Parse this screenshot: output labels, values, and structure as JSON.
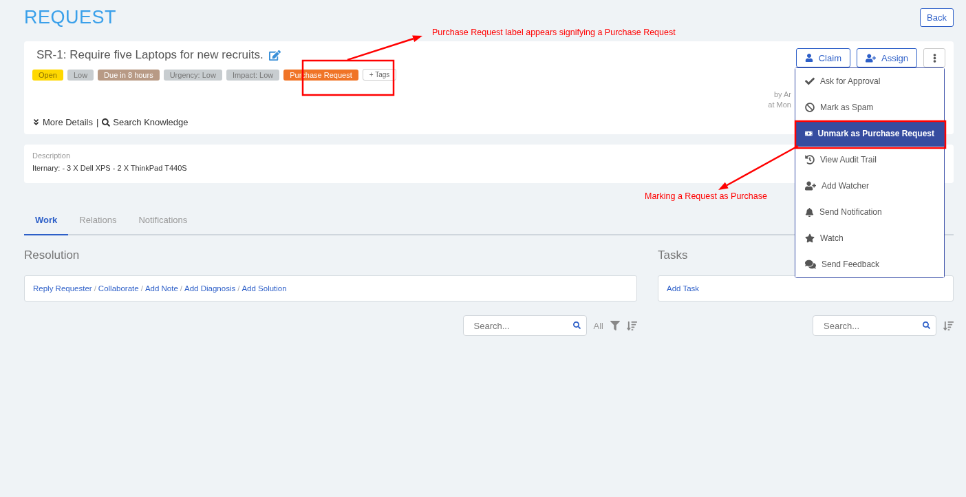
{
  "page": {
    "title": "REQUEST",
    "back_button": "Back"
  },
  "request": {
    "title": "SR-1: Require five Laptops for new recruits.",
    "tags": [
      {
        "label": "Open",
        "color": "#ffd800"
      },
      {
        "label": "Low",
        "color": "#c8cdd0"
      },
      {
        "label": "Due in 8 hours",
        "color": "#b89a85"
      },
      {
        "label": "Urgency: Low",
        "color": "#c8cdd0"
      },
      {
        "label": "Impact: Low",
        "color": "#c8cdd0"
      },
      {
        "label": "Purchase Request",
        "color": "#f07427"
      }
    ],
    "add_tags": "+ Tags",
    "more_details": "More Details",
    "divider": "|",
    "search_knowledge": "Search Knowledge",
    "by": "by Ar",
    "at": "at Mon",
    "buttons": [
      {
        "label": "Claim",
        "kind": "claim"
      },
      {
        "label": "Assign",
        "kind": "assign"
      }
    ]
  },
  "menu": [
    {
      "label": "Ask for Approval",
      "kind": "check",
      "selected": false
    },
    {
      "label": "Mark as Spam",
      "kind": "ban",
      "selected": false
    },
    {
      "label": "Unmark as Purchase Request",
      "kind": "money",
      "selected": true
    },
    {
      "label": "View Audit Trail",
      "kind": "history",
      "selected": false
    },
    {
      "label": "Add Watcher",
      "kind": "user-plus",
      "selected": false
    },
    {
      "label": "Send Notification",
      "kind": "bell",
      "selected": false
    },
    {
      "label": "Watch",
      "kind": "star",
      "selected": false
    },
    {
      "label": "Send Feedback",
      "kind": "comments",
      "selected": false
    }
  ],
  "description": {
    "label": "Description",
    "text": "Iternary: - 3 X Dell XPS - 2 X ThinkPad T440S"
  },
  "tabs": [
    {
      "label": "Work",
      "selected": true
    },
    {
      "label": "Relations",
      "selected": false
    },
    {
      "label": "Notifications",
      "selected": false
    }
  ],
  "resolution": {
    "heading": "Resolution",
    "actions": [
      {
        "kind": "link",
        "text": "Reply Requester"
      },
      {
        "kind": "separator",
        "text": "/"
      },
      {
        "kind": "link",
        "text": "Collaborate"
      },
      {
        "kind": "separator",
        "text": "/"
      },
      {
        "kind": "link",
        "text": "Add Note"
      },
      {
        "kind": "separator",
        "text": "/"
      },
      {
        "kind": "link",
        "text": "Add Diagnosis"
      },
      {
        "kind": "separator",
        "text": "/"
      },
      {
        "kind": "link",
        "text": "Add Solution"
      }
    ],
    "search_placeholder": "Search...",
    "filter_label": "All"
  },
  "tasks": {
    "heading": "Tasks",
    "action": "Add Task",
    "search_placeholder": "Search..."
  },
  "annotations": {
    "top": "Purchase Request label appears signifying a Purchase Request",
    "bottom": "Marking a Request as Purchase"
  }
}
